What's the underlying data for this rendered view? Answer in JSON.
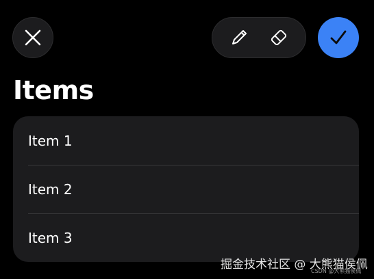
{
  "header": {
    "title": "Items",
    "close_icon": "close-icon",
    "pencil_icon": "pencil-icon",
    "eraser_icon": "eraser-icon",
    "checkmark_icon": "checkmark-icon"
  },
  "list": {
    "items": [
      {
        "label": "Item 1"
      },
      {
        "label": "Item 2"
      },
      {
        "label": "Item 3"
      }
    ]
  },
  "watermark": {
    "text": "掘金技术社区 @ 大熊猫侯佩",
    "small_text": "CSDN @大熊猫侯佩"
  },
  "colors": {
    "background": "#000000",
    "control": "#1c1c1e",
    "card": "#1c1c1e",
    "accent": "#3b82f6",
    "separator": "#38383a",
    "text": "#ffffff"
  }
}
